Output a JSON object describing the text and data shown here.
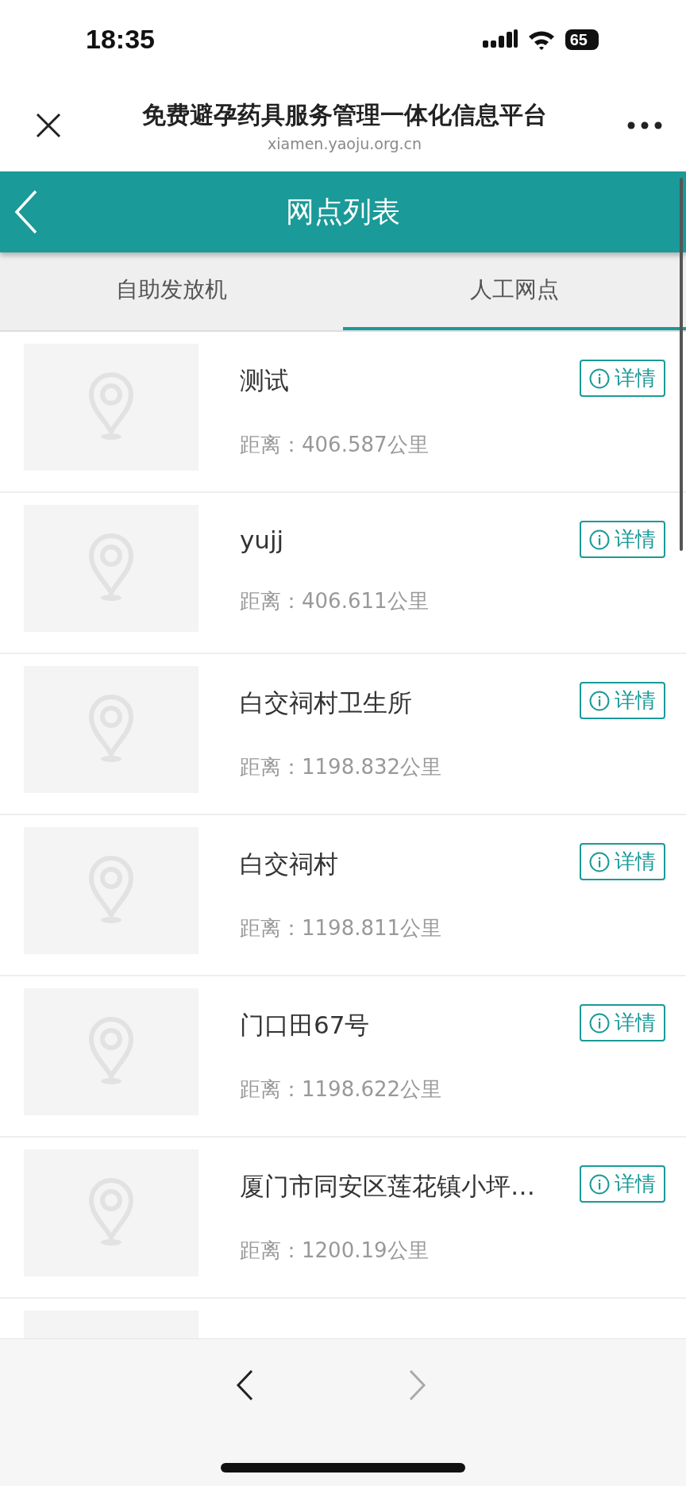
{
  "status_bar": {
    "time": "18:35",
    "battery": "65"
  },
  "browser": {
    "title": "免费避孕药具服务管理一体化信息平台",
    "url": "xiamen.yaoju.org.cn"
  },
  "app_bar": {
    "title": "网点列表"
  },
  "tabs": [
    {
      "label": "自助发放机",
      "selected": false
    },
    {
      "label": "人工网点",
      "selected": true
    }
  ],
  "sites": [
    {
      "name": "测试",
      "distance": "距离：406.587公里",
      "button": "详情"
    },
    {
      "name": "yujj",
      "distance": "距离：406.611公里",
      "button": "详情"
    },
    {
      "name": "白交祠村卫生所",
      "distance": "距离：1198.832公里",
      "button": "详情"
    },
    {
      "name": "白交祠村",
      "distance": "距离：1198.811公里",
      "button": "详情"
    },
    {
      "name": "门口田67号",
      "distance": "距离：1198.622公里",
      "button": "详情"
    },
    {
      "name": "厦门市同安区莲花镇小坪…",
      "distance": "距离：1200.19公里",
      "button": "详情"
    },
    {
      "kind": "partial"
    }
  ]
}
